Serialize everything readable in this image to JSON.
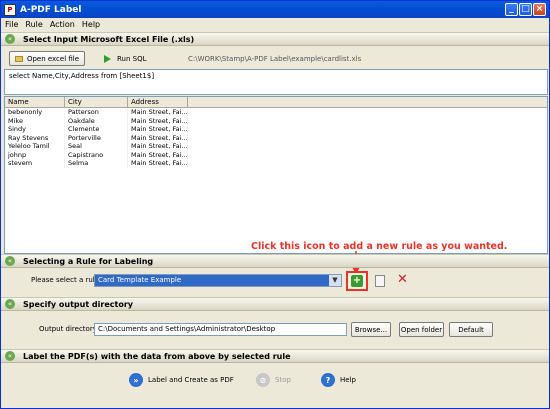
{
  "window": {
    "title": "A-PDF Label"
  },
  "menu": [
    "File",
    "Rule",
    "Action",
    "Help"
  ],
  "section1": {
    "label": "Select Input Microsoft Excel File (.xls)"
  },
  "toolbar": {
    "open_excel": "Open excel file",
    "run_sql": "Run SQL",
    "file_path": "C:\\WORK\\Stamp\\A-PDF Label\\example\\cardlist.xls"
  },
  "sql_text": "select Name,City,Address from [Sheet1$]",
  "table": {
    "headers": [
      "Name",
      "City",
      "Address"
    ],
    "rows": [
      [
        "bebenonly",
        "Patterson",
        "Main Street, Fai..."
      ],
      [
        "Mike",
        "Oakdale",
        "Main Street, Fai..."
      ],
      [
        "Sindy",
        "Clemente",
        "Main Street, Fai..."
      ],
      [
        "Ray Stevens",
        "Porterville",
        "Main Street, Fai..."
      ],
      [
        "Yeleloo Tamil",
        "Seal",
        "Main Street, Fai..."
      ],
      [
        "johnp",
        "Capistrano",
        "Main Street, Fai..."
      ],
      [
        "stevem",
        "Selma",
        "Main Street, Fai..."
      ]
    ]
  },
  "annotation": "Click this icon to add a new rule as you wanted.",
  "section2": {
    "label": "Selecting a Rule for Labeling",
    "select_label": "Please select a rule:",
    "selected_rule": "Card Template Example"
  },
  "section3": {
    "label": "Specify output directory",
    "dir_label": "Output directory:",
    "dir_value": "C:\\Documents and Settings\\Administrator\\Desktop",
    "browse": "Browse...",
    "open_folder": "Open folder",
    "default": "Default"
  },
  "section4": {
    "label": "Label the PDF(s) with the data from above by selected rule"
  },
  "actions": {
    "create": "Label and Create as PDF",
    "stop": "Stop",
    "help": "Help"
  },
  "colors": {
    "titlebar": "#0a5bda",
    "annotation": "#e8332a",
    "selection": "#316ac5"
  }
}
